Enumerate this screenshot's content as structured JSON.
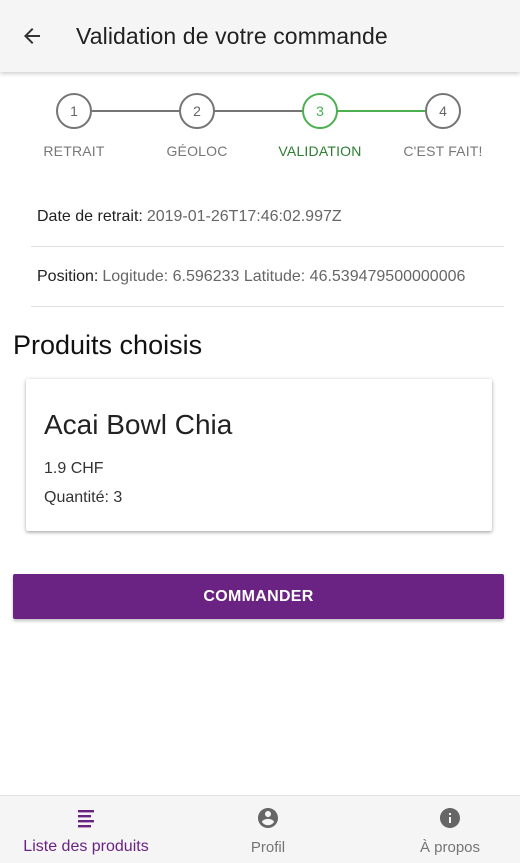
{
  "appbar": {
    "title": "Validation de votre commande"
  },
  "stepper": {
    "steps": [
      {
        "number": "1",
        "label": "RETRAIT"
      },
      {
        "number": "2",
        "label": "GÉOLOC"
      },
      {
        "number": "3",
        "label": "VALIDATION"
      },
      {
        "number": "4",
        "label": "C'EST FAIT!"
      }
    ],
    "current_step": 3
  },
  "details": {
    "date_label": "Date de retrait:",
    "date_value": "2019-01-26T17:46:02.997Z",
    "position_label": "Position:",
    "position_value": "Logitude: 6.596233 Latitude: 46.539479500000006"
  },
  "products": {
    "title": "Produits choisis",
    "items": [
      {
        "name": "Acai Bowl Chia",
        "price": "1.9 CHF",
        "quantity": "Quantité: 3"
      }
    ]
  },
  "actions": {
    "order_label": "COMMANDER"
  },
  "bottom_nav": {
    "items": [
      {
        "label": "Liste des produits",
        "icon": "list-icon",
        "active": true
      },
      {
        "label": "Profil",
        "icon": "account-circle-icon",
        "active": false
      },
      {
        "label": "À propos",
        "icon": "info-icon",
        "active": false
      }
    ]
  },
  "colors": {
    "primary": "#6a2382",
    "step_active": "#4caf50",
    "step_inactive": "#757575"
  }
}
